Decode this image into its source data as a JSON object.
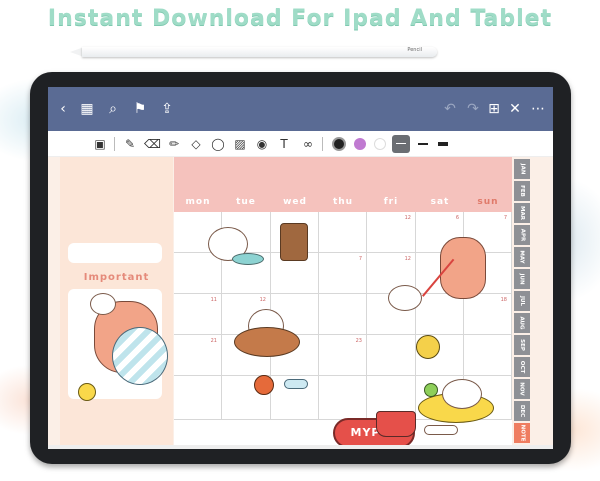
{
  "headline": "Instant Download For Ipad And Tablet",
  "pencil_brand": "Pencil",
  "appbar": {
    "icons": [
      "back-icon",
      "grid-icon",
      "search-icon",
      "bookmark-icon",
      "share-icon",
      "undo-icon",
      "redo-icon",
      "add-page-icon",
      "close-icon",
      "more-icon"
    ],
    "glyphs": {
      "back": "‹",
      "grid": "▦",
      "search": "⌕",
      "bookmark": "⚑",
      "share": "⇪",
      "undo": "↶",
      "redo": "↷",
      "add": "⊞",
      "close": "✕",
      "more": "⋯"
    }
  },
  "toolbar": {
    "glyphs": {
      "doc": "▣",
      "pen": "✎",
      "eraser": "⌫",
      "highlighter": "✏",
      "shapes": "◇",
      "lasso": "◯",
      "image": "▨",
      "camera": "◉",
      "text": "T",
      "link": "∞"
    },
    "colors": [
      "#222222",
      "#c07ad1",
      "#ffffff"
    ],
    "accent": "#5a6b94"
  },
  "page": {
    "important_label": "Important",
    "days": [
      "mon",
      "tue",
      "wed",
      "thu",
      "fri",
      "sat",
      "sun"
    ],
    "weeks": [
      [
        "",
        "",
        "",
        "",
        "12",
        "6",
        "7"
      ],
      [
        "",
        "",
        "",
        "7",
        "12",
        "",
        ""
      ],
      [
        "11",
        "12",
        "",
        "",
        "",
        "",
        "18"
      ],
      [
        "21",
        "22",
        "",
        "23",
        "",
        "",
        ""
      ],
      [
        "",
        "",
        "",
        "",
        "",
        "",
        ""
      ]
    ],
    "sticker_text": "MYPET",
    "month_tabs": [
      "JAN",
      "FEB",
      "MAR",
      "APR",
      "MAY",
      "JUN",
      "JUL",
      "AUG",
      "SEP",
      "OCT",
      "NOV",
      "DEC",
      "NOTE"
    ]
  }
}
